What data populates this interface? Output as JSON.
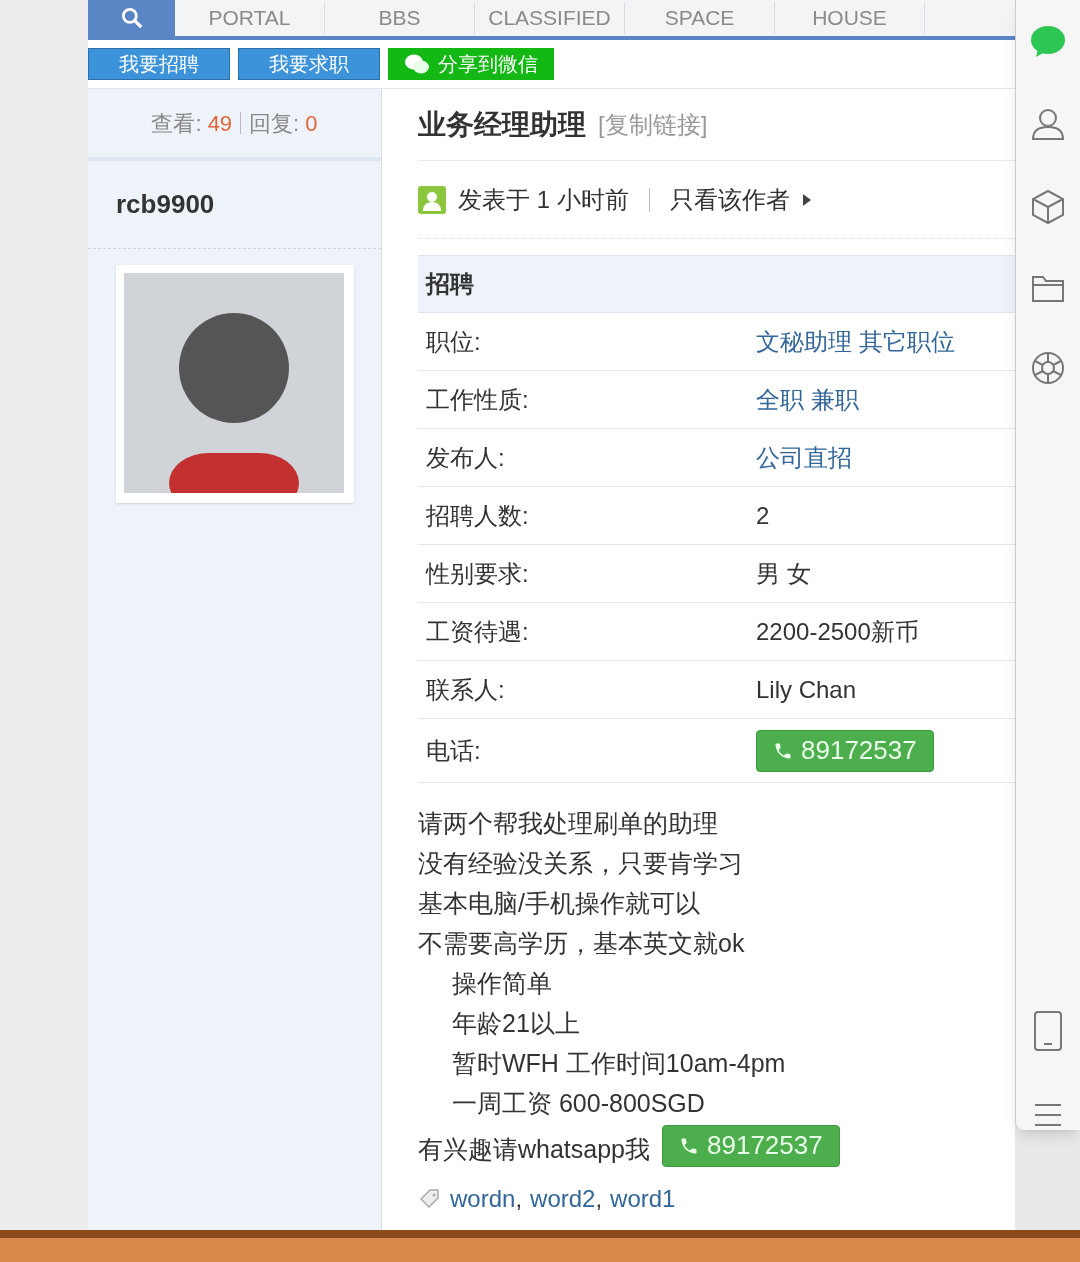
{
  "nav": [
    {
      "label": "PORTAL"
    },
    {
      "label": "BBS"
    },
    {
      "label": "CLASSIFIED"
    },
    {
      "label": "SPACE"
    },
    {
      "label": "HOUSE"
    }
  ],
  "actions": [
    {
      "label": "我要招聘",
      "kind": "blue"
    },
    {
      "label": "我要求职",
      "kind": "blue"
    },
    {
      "label": "分享到微信",
      "kind": "wechat"
    }
  ],
  "stats": {
    "views_label": "查看:",
    "views": "49",
    "replies_label": "回复:",
    "replies": "0"
  },
  "author": "rcb9900",
  "post": {
    "title": "业务经理助理",
    "copy_link": "[复制链接]",
    "posted": "发表于 1 小时前",
    "only_author": "只看该作者"
  },
  "table": {
    "heading": "招聘",
    "rows": [
      {
        "label": "职位:",
        "value": "文秘助理 其它职位",
        "kind": "link"
      },
      {
        "label": "工作性质:",
        "value": "全职 兼职",
        "kind": "link"
      },
      {
        "label": "发布人:",
        "value": "公司直招",
        "kind": "link"
      },
      {
        "label": "招聘人数:",
        "value": "2",
        "kind": "text"
      },
      {
        "label": "性别要求:",
        "value": "男 女",
        "kind": "text"
      },
      {
        "label": "工资待遇:",
        "value": "2200-2500新币",
        "kind": "text"
      },
      {
        "label": "联系人:",
        "value": "Lily Chan",
        "kind": "text"
      },
      {
        "label": "电话:",
        "value": "89172537",
        "kind": "phone"
      }
    ]
  },
  "body": [
    {
      "text": "请两个帮我处理刷单的助理",
      "indented": false
    },
    {
      "text": "没有经验没关系，只要肯学习",
      "indented": false
    },
    {
      "text": "基本电脑/手机操作就可以",
      "indented": false
    },
    {
      "text": "不需要高学历，基本英文就ok",
      "indented": false
    },
    {
      "text": "操作简单",
      "indented": true
    },
    {
      "text": "年龄21以上",
      "indented": true
    },
    {
      "text": "暂时WFH 工作时间10am-4pm",
      "indented": true
    },
    {
      "text": "一周工资 600-800SGD",
      "indented": true
    }
  ],
  "contact": {
    "text": "有兴趣请whatsapp我",
    "phone": "89172537"
  },
  "tags": [
    "wordn",
    "word2",
    "word1"
  ],
  "tag_separator": ","
}
